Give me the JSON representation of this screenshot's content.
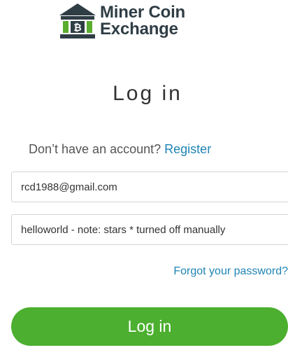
{
  "brand": {
    "name_line1": "Miner Coin",
    "name_line2": "Exchange",
    "logo_icon": "bank-bitcoin-icon"
  },
  "heading": "Log in",
  "signup": {
    "prompt": "Don’t have an account?",
    "link_label": "Register"
  },
  "form": {
    "email_value": "rcd1988@gmail.com",
    "password_value": "helloworld - note: stars * turned off manually"
  },
  "forgot_label": "Forgot your password?",
  "submit_label": "Log in",
  "colors": {
    "accent": "#4caf2f",
    "link": "#1f84b5",
    "brand_text": "#2f3d45"
  }
}
